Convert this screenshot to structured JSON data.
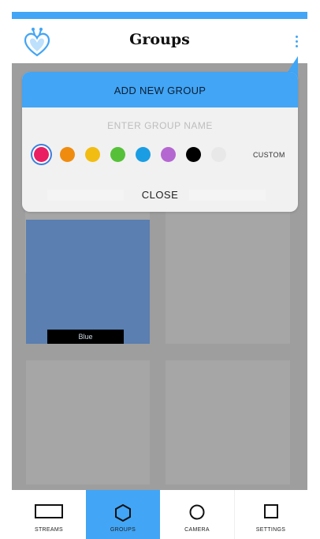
{
  "header": {
    "title": "Groups"
  },
  "tiles": {
    "blue_label": "Blue"
  },
  "modal": {
    "title": "ADD NEW GROUP",
    "input_placeholder": "ENTER GROUP NAME",
    "colors": [
      "#e91e63",
      "#ef8c0f",
      "#f2bd12",
      "#56c138",
      "#1b9de3",
      "#b567d1",
      "#000000",
      "#e8e8e8"
    ],
    "selected_color": "#e91e63",
    "custom_label": "CUSTOM",
    "close_label": "CLOSE"
  },
  "nav": {
    "items": [
      {
        "label": "STREAMS",
        "icon": "rectangle-icon"
      },
      {
        "label": "GROUPS",
        "icon": "hexagon-icon",
        "active": true
      },
      {
        "label": "CAMERA",
        "icon": "circle-icon"
      },
      {
        "label": "SETTINGS",
        "icon": "square-icon"
      }
    ]
  },
  "colors": {
    "accent": "#42a5f5",
    "overlay": "#9e9e9e",
    "tile_blue": "#5a7fb0"
  }
}
